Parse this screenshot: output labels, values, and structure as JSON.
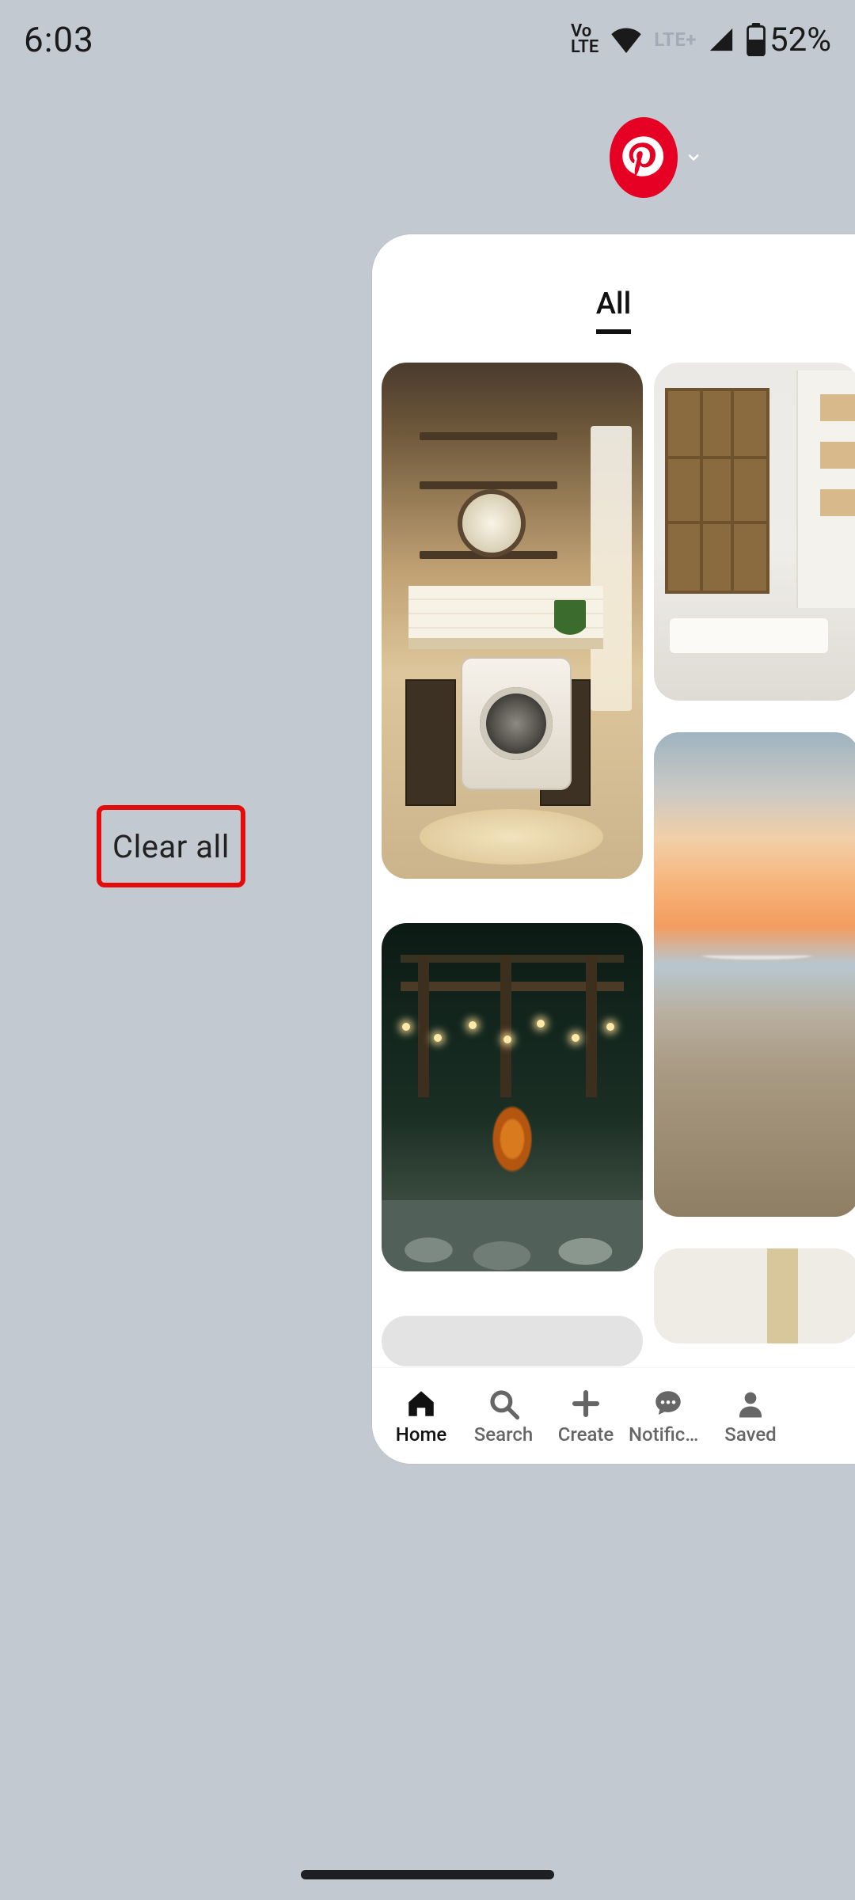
{
  "status_bar": {
    "time": "6:03",
    "volte_line1": "Vo",
    "volte_line2": "LTE",
    "network_label": "LTE+",
    "battery_percent": "52%"
  },
  "recents": {
    "clear_all_label": "Clear all",
    "app_name": "Pinterest"
  },
  "app": {
    "feed_tab_active": "All",
    "pins": {
      "col_a": [
        {
          "id": "laundry-nook"
        },
        {
          "id": "backyard-patio-night"
        },
        {
          "id": "loading-blank"
        }
      ],
      "col_b": [
        {
          "id": "entryway-door"
        },
        {
          "id": "sunset-beach"
        },
        {
          "id": "interior-room-peek"
        }
      ]
    },
    "nav": {
      "home": "Home",
      "search": "Search",
      "create": "Create",
      "notif": "Notificat...",
      "saved": "Saved",
      "active": "home"
    }
  },
  "colors": {
    "pinterest_red": "#e60023",
    "highlight_red": "#e40b0b",
    "bg": "#c3c9d1"
  }
}
